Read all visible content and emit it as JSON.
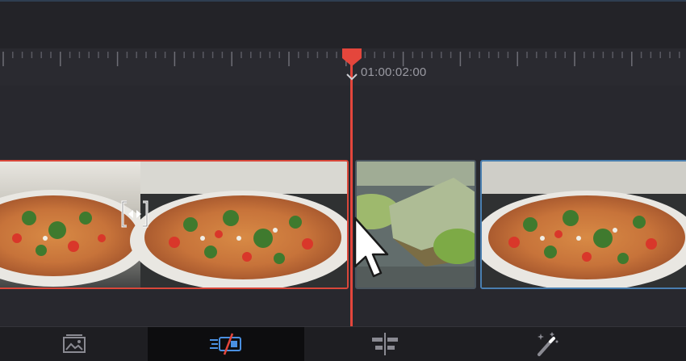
{
  "timeline": {
    "timecode": "01:00:02:00"
  },
  "colors": {
    "playhead": "#e4463c",
    "selected_clip_border": "#d9473a",
    "clip_border_blue": "#4a7fb0",
    "active_tab_icon": "#4a8fe0",
    "background": "#28282e"
  },
  "clips": [
    {
      "name": "pizza-clip-selected",
      "icon": "trim-handle-icon"
    },
    {
      "name": "lime-popsicle-clip"
    },
    {
      "name": "pizza-clip-right"
    }
  ],
  "bottom_tabs": [
    {
      "name": "media-tab",
      "icon": "image-gallery-icon",
      "active": false
    },
    {
      "name": "cut-tab",
      "icon": "timeline-cut-icon",
      "active": true
    },
    {
      "name": "edit-tab",
      "icon": "align-tracks-icon",
      "active": false
    },
    {
      "name": "effects-tab",
      "icon": "magic-wand-icon",
      "active": false
    }
  ]
}
